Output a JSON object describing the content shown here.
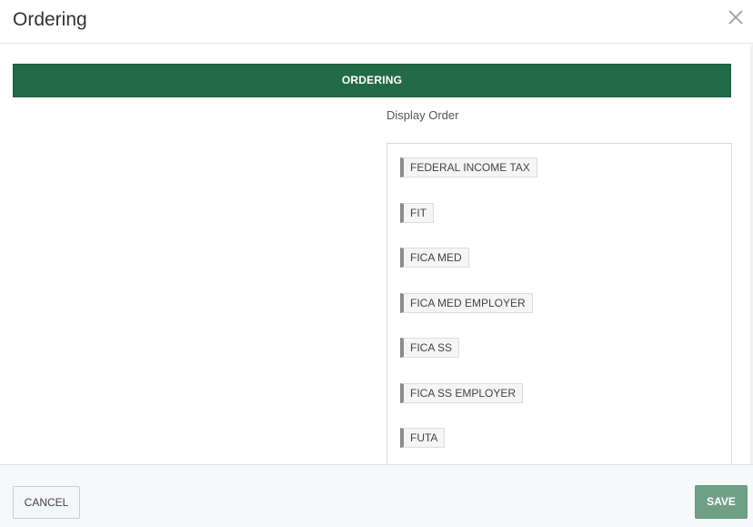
{
  "dialog": {
    "title": "Ordering",
    "close_icon": "close-icon"
  },
  "section": {
    "banner_label": "ORDERING"
  },
  "display_order": {
    "label": "Display Order",
    "items": [
      "FEDERAL INCOME TAX",
      "FIT",
      "FICA MED",
      "FICA MED EMPLOYER",
      "FICA SS",
      "FICA SS EMPLOYER",
      "FUTA"
    ]
  },
  "footer": {
    "cancel_label": "CANCEL",
    "save_label": "SAVE"
  },
  "colors": {
    "banner": "#236a47",
    "save_button": "#6f9f85",
    "item_handle": "#8c8c8c"
  }
}
